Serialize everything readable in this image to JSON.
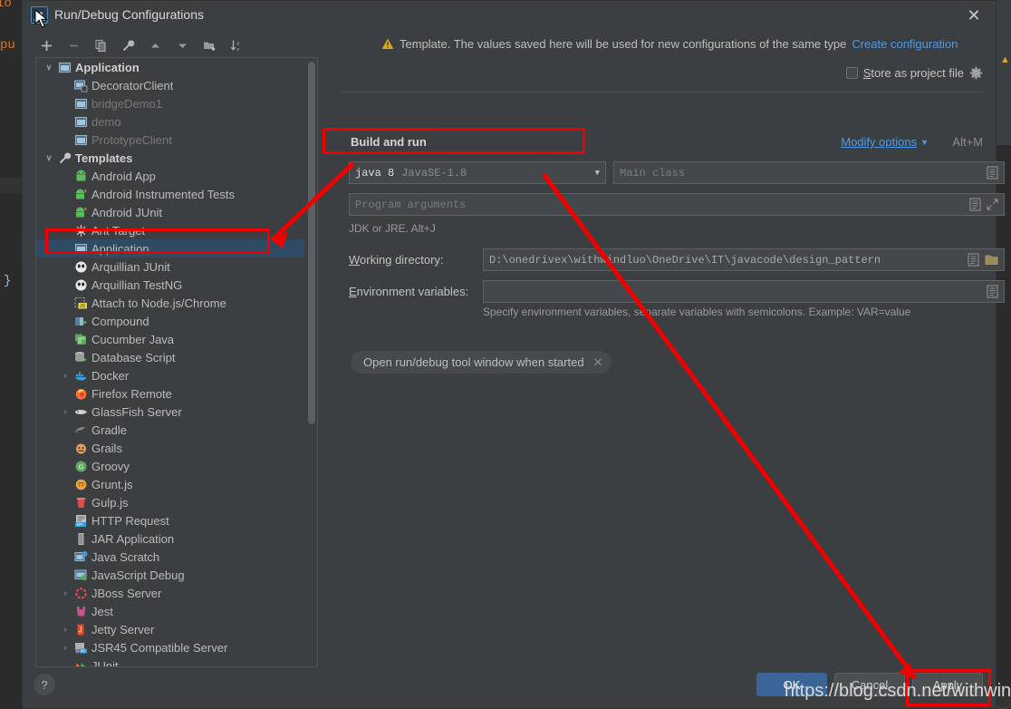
{
  "background": {
    "code_fragment_1": "io",
    "code_fragment_2": "pu",
    "code_fragment_3": "}"
  },
  "dialog": {
    "title": "Run/Debug Configurations",
    "icon": "intellij-idea-icon",
    "close_label": "✕"
  },
  "toolbar": {
    "items": [
      {
        "name": "add-configuration-button",
        "icon": "plus-icon",
        "title": "Add New Configuration"
      },
      {
        "name": "remove-configuration-button",
        "icon": "minus-icon",
        "title": "Remove Configuration"
      },
      {
        "name": "copy-configuration-button",
        "icon": "copy-icon",
        "title": "Copy Configuration"
      },
      {
        "name": "edit-templates-button",
        "icon": "wrench-icon",
        "title": "Edit Templates"
      },
      {
        "name": "move-up-button",
        "icon": "arrow-up-icon",
        "title": "Move Up"
      },
      {
        "name": "move-down-button",
        "icon": "arrow-down-icon",
        "title": "Move Down"
      },
      {
        "name": "new-folder-button",
        "icon": "new-folder-icon",
        "title": "Create New Folder"
      },
      {
        "name": "sort-configurations-button",
        "icon": "sort-az-icon",
        "title": "Sort Configurations"
      }
    ]
  },
  "tree": {
    "items": [
      {
        "label": "Application",
        "icon": "application-icon",
        "indent": 0,
        "twisty": "expanded",
        "bold": true,
        "dim": false,
        "selected": false
      },
      {
        "label": "DecoratorClient",
        "icon": "app-run-icon",
        "indent": 1,
        "twisty": "none",
        "bold": false,
        "dim": false,
        "selected": false
      },
      {
        "label": "bridgeDemo1",
        "icon": "application-icon",
        "indent": 1,
        "twisty": "none",
        "bold": false,
        "dim": true,
        "selected": false
      },
      {
        "label": "demo",
        "icon": "application-icon",
        "indent": 1,
        "twisty": "none",
        "bold": false,
        "dim": true,
        "selected": false
      },
      {
        "label": "PrototypeClient",
        "icon": "application-icon",
        "indent": 1,
        "twisty": "none",
        "bold": false,
        "dim": true,
        "selected": false
      },
      {
        "label": "Templates",
        "icon": "wrench-icon",
        "indent": 0,
        "twisty": "expanded",
        "bold": true,
        "dim": false,
        "selected": false
      },
      {
        "label": "Android App",
        "icon": "android-icon",
        "indent": 1,
        "twisty": "none",
        "bold": false,
        "dim": false,
        "selected": false
      },
      {
        "label": "Android Instrumented Tests",
        "icon": "android-test-icon",
        "indent": 1,
        "twisty": "none",
        "bold": false,
        "dim": false,
        "selected": false
      },
      {
        "label": "Android JUnit",
        "icon": "android-test-icon",
        "indent": 1,
        "twisty": "none",
        "bold": false,
        "dim": false,
        "selected": false
      },
      {
        "label": "Ant Target",
        "icon": "ant-icon",
        "indent": 1,
        "twisty": "none",
        "bold": false,
        "dim": false,
        "selected": false
      },
      {
        "label": "Application",
        "icon": "application-icon",
        "indent": 1,
        "twisty": "none",
        "bold": false,
        "dim": false,
        "selected": true
      },
      {
        "label": "Arquillian JUnit",
        "icon": "arquillian-icon",
        "indent": 1,
        "twisty": "none",
        "bold": false,
        "dim": false,
        "selected": false
      },
      {
        "label": "Arquillian TestNG",
        "icon": "arquillian-icon",
        "indent": 1,
        "twisty": "none",
        "bold": false,
        "dim": false,
        "selected": false
      },
      {
        "label": "Attach to Node.js/Chrome",
        "icon": "nodejs-attach-icon",
        "indent": 1,
        "twisty": "none",
        "bold": false,
        "dim": false,
        "selected": false
      },
      {
        "label": "Compound",
        "icon": "compound-icon",
        "indent": 1,
        "twisty": "none",
        "bold": false,
        "dim": false,
        "selected": false
      },
      {
        "label": "Cucumber Java",
        "icon": "cucumber-icon",
        "indent": 1,
        "twisty": "none",
        "bold": false,
        "dim": false,
        "selected": false
      },
      {
        "label": "Database Script",
        "icon": "database-icon",
        "indent": 1,
        "twisty": "none",
        "bold": false,
        "dim": false,
        "selected": false
      },
      {
        "label": "Docker",
        "icon": "docker-icon",
        "indent": 1,
        "twisty": "collapsed",
        "bold": false,
        "dim": false,
        "selected": false
      },
      {
        "label": "Firefox Remote",
        "icon": "firefox-icon",
        "indent": 1,
        "twisty": "none",
        "bold": false,
        "dim": false,
        "selected": false
      },
      {
        "label": "GlassFish Server",
        "icon": "glassfish-icon",
        "indent": 1,
        "twisty": "collapsed",
        "bold": false,
        "dim": false,
        "selected": false
      },
      {
        "label": "Gradle",
        "icon": "gradle-icon",
        "indent": 1,
        "twisty": "none",
        "bold": false,
        "dim": false,
        "selected": false
      },
      {
        "label": "Grails",
        "icon": "grails-icon",
        "indent": 1,
        "twisty": "none",
        "bold": false,
        "dim": false,
        "selected": false
      },
      {
        "label": "Groovy",
        "icon": "groovy-icon",
        "indent": 1,
        "twisty": "none",
        "bold": false,
        "dim": false,
        "selected": false
      },
      {
        "label": "Grunt.js",
        "icon": "grunt-icon",
        "indent": 1,
        "twisty": "none",
        "bold": false,
        "dim": false,
        "selected": false
      },
      {
        "label": "Gulp.js",
        "icon": "gulp-icon",
        "indent": 1,
        "twisty": "none",
        "bold": false,
        "dim": false,
        "selected": false
      },
      {
        "label": "HTTP Request",
        "icon": "http-request-icon",
        "indent": 1,
        "twisty": "none",
        "bold": false,
        "dim": false,
        "selected": false
      },
      {
        "label": "JAR Application",
        "icon": "jar-icon",
        "indent": 1,
        "twisty": "none",
        "bold": false,
        "dim": false,
        "selected": false
      },
      {
        "label": "Java Scratch",
        "icon": "java-scratch-icon",
        "indent": 1,
        "twisty": "none",
        "bold": false,
        "dim": false,
        "selected": false
      },
      {
        "label": "JavaScript Debug",
        "icon": "js-debug-icon",
        "indent": 1,
        "twisty": "none",
        "bold": false,
        "dim": false,
        "selected": false
      },
      {
        "label": "JBoss Server",
        "icon": "jboss-icon",
        "indent": 1,
        "twisty": "collapsed",
        "bold": false,
        "dim": false,
        "selected": false
      },
      {
        "label": "Jest",
        "icon": "jest-icon",
        "indent": 1,
        "twisty": "none",
        "bold": false,
        "dim": false,
        "selected": false
      },
      {
        "label": "Jetty Server",
        "icon": "jetty-icon",
        "indent": 1,
        "twisty": "collapsed",
        "bold": false,
        "dim": false,
        "selected": false
      },
      {
        "label": "JSR45 Compatible Server",
        "icon": "jsr45-icon",
        "indent": 1,
        "twisty": "collapsed",
        "bold": false,
        "dim": false,
        "selected": false
      },
      {
        "label": "JUnit",
        "icon": "junit-icon",
        "indent": 1,
        "twisty": "none",
        "bold": false,
        "dim": false,
        "selected": false
      }
    ]
  },
  "right": {
    "notice_text": "Template. The values saved here will be used for new configurations of the same type",
    "create_configuration_link": "Create configuration",
    "store_as_project_file_label": "Store as project file",
    "section_title": "Build and run",
    "modify_options_link": "Modify options",
    "modify_options_shortcut": "Alt+M",
    "jdk": {
      "value_primary": "java 8",
      "value_secondary": "JavaSE-1.8"
    },
    "main_class_placeholder": "Main class",
    "program_arguments_placeholder": "Program arguments",
    "jdk_hint": "JDK or JRE. Alt+J",
    "working_directory_label": "Working directory:",
    "working_directory_value": "D:\\onedrivex\\withwindluo\\OneDrive\\IT\\javacode\\design_pattern",
    "environment_variables_label": "Environment variables:",
    "environment_variables_value": "",
    "environment_hint": "Specify environment variables, separate variables with semicolons. Example: VAR=value",
    "option_chip_label": "Open run/debug tool window when started",
    "option_chip_remove": "✕"
  },
  "footer": {
    "help_label": "?",
    "ok_label": "OK",
    "cancel_label": "Cancel",
    "apply_label": "Apply"
  },
  "watermark": {
    "text": "https://blog.csdn.net/withwindluo"
  },
  "colors": {
    "accent_blue": "#4c9be8",
    "primary_button": "#3a6596",
    "selection": "#2f4a63",
    "annotation_red": "#f00000",
    "panel_bg": "#3c3f41",
    "field_bg": "#45484a",
    "warning_amber": "#d9a520"
  }
}
